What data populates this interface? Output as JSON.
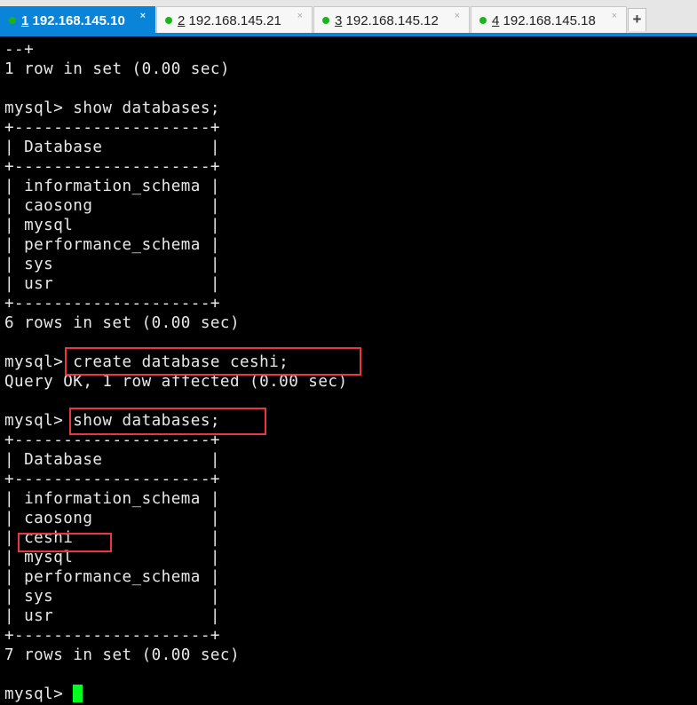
{
  "tabs": [
    {
      "num": "1",
      "host": "192.168.145.10",
      "active": true,
      "status": "connected"
    },
    {
      "num": "2",
      "host": "192.168.145.21",
      "active": false,
      "status": "connected"
    },
    {
      "num": "3",
      "host": "192.168.145.12",
      "active": false,
      "status": "connected"
    },
    {
      "num": "4",
      "host": "192.168.145.18",
      "active": false,
      "status": "connected"
    }
  ],
  "close_glyph": "×",
  "add_tab_label": "+",
  "colors": {
    "accent": "#0a84d8",
    "status_dot": "#1cb31c",
    "highlight_box": "#e8383d",
    "cursor": "#00ff1e"
  },
  "terminal": {
    "lines": [
      "--+",
      "1 row in set (0.00 sec)",
      "",
      "mysql> show databases;",
      "+--------------------+",
      "| Database           |",
      "+--------------------+",
      "| information_schema |",
      "| caosong            |",
      "| mysql              |",
      "| performance_schema |",
      "| sys                |",
      "| usr                |",
      "+--------------------+",
      "6 rows in set (0.00 sec)",
      "",
      "mysql> create database ceshi;",
      "Query OK, 1 row affected (0.00 sec)",
      "",
      "mysql> show databases;",
      "+--------------------+",
      "| Database           |",
      "+--------------------+",
      "| information_schema |",
      "| caosong            |",
      "| ceshi              |",
      "| mysql              |",
      "| performance_schema |",
      "| sys                |",
      "| usr                |",
      "+--------------------+",
      "7 rows in set (0.00 sec)",
      ""
    ],
    "prompt": "mysql> "
  }
}
